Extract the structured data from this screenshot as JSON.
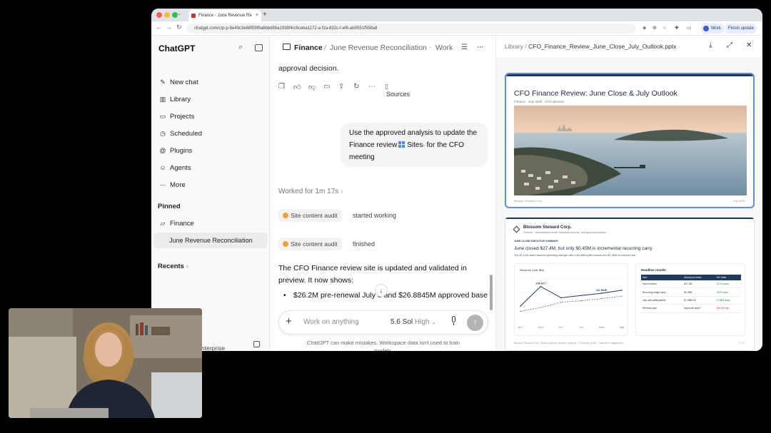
{
  "browser": {
    "tab_title": "Finance - June Revenue Re",
    "new_tab": "+",
    "url": "chatgpt.com/c/p-p-8e49c3e68f59f9a6bbd98a1938f4/c6ceba1172-a f2a-832c-f-ef6-ab0551f558a8",
    "profile_label": "Work",
    "finish_label": "Finish update"
  },
  "sidebar": {
    "brand": "ChatGPT",
    "items": [
      {
        "label": "New chat",
        "icon": "edit-icon"
      },
      {
        "label": "Library",
        "icon": "library-icon"
      },
      {
        "label": "Projects",
        "icon": "folder-icon"
      },
      {
        "label": "Scheduled",
        "icon": "clock-icon"
      },
      {
        "label": "Plugins",
        "icon": "plugin-icon"
      },
      {
        "label": "Agents",
        "icon": "robot-icon"
      },
      {
        "label": "More",
        "icon": "more-icon"
      }
    ],
    "pinned_heading": "Pinned",
    "pinned_project": "Finance",
    "pinned_conversation": "June Revenue Reconciliation",
    "recents_heading": "Recents",
    "recents_chevron": "›",
    "plan_label": "nterprise"
  },
  "chat": {
    "breadcrumb": {
      "project": "Finance",
      "separator": "/",
      "conversation": "June Revenue Reconciliation",
      "dot": "·",
      "mode": "Work"
    },
    "cutoff_text": "approval decision.",
    "sources_label": "Sources",
    "user_message": {
      "before": "Use the approved analysis to update the Finance review",
      "chip": "Sites",
      "after": "for the CFO meeting"
    },
    "worked_for": "Worked for 1m 17s",
    "tool_events": [
      {
        "name": "Site content audit",
        "status": "started working"
      },
      {
        "name": "Site content audit",
        "status": "finished"
      }
    ],
    "response_intro": "The CFO Finance review site is updated and validated in preview. It now shows:",
    "response_bullet": "$26.2M pre-renewal July ",
    "response_bullet_tail": "e and $26.8845M approved base",
    "composer": {
      "placeholder": "Work on anything",
      "model": "5.6 Sol",
      "effort": "High"
    },
    "disclaimer": "ChatGPT can make mistakes. Workspace data isn't used to train models."
  },
  "preview": {
    "library_label": "Library",
    "separator": "/",
    "filename": "CFO_Finance_Review_June_Close_July_Outlook.pptx",
    "slide1": {
      "title": "CFO Finance Review: June Close & July Outlook",
      "subtitle": "Finance · July 2025 · CFO decision",
      "footer_left": "Blossom Steward Corp.",
      "footer_right": "July 2025"
    },
    "slide2": {
      "company": "Blossom Steward Corp.",
      "subtitle": "Finance · Assumptions audit, modeled controls, and approval actions",
      "kicker": "JUNE CLOSE EXECUTIVE SUMMARY",
      "headline": "June closed $27.4M, but only $0.45M is incremental recurring carry",
      "detail": "The $1.01M asset takeout operating strength with a $0.68M uplift forward and $1.38M of renewal risk.",
      "chart_title": "Revenue (unit: $M)",
      "table_title": "Headline results",
      "table_headers": [
        "Item",
        "Actual (vs close)",
        "YoY delta"
      ],
      "table_rows": [
        [
          "June revenue",
          "$27.4M",
          "+6.1% carry"
        ],
        [
          "Recurring usage carry",
          "$0.45M",
          "+67% carry"
        ],
        [
          "July rate uplift/pipeline",
          "$1.38M net",
          "+0.68M adds"
        ],
        [
          "Renewal plan",
          "Approval watch",
          "-$11.4M risk"
        ]
      ],
      "footer_left": "Blossom Steward Corp.     Finance general revenue analysis · Financing model · Customer engagement",
      "footer_right": "2 / 5"
    }
  },
  "chart_data": {
    "type": "line",
    "title": "Revenue (unit: $M)",
    "categories": [
      "Jun T",
      "Jun E",
      "Jul T",
      "Cur",
      "Trave",
      "High"
    ],
    "annotations": [
      "JUN ACT",
      "JUL BASE"
    ],
    "series": [
      {
        "values": [
          24.8,
          27.4,
          25.9,
          26.2,
          26.5,
          26.9
        ],
        "style": "solid",
        "color": "#1f3a5f"
      },
      {
        "values": [
          24.1,
          24.6,
          25.3,
          25.5,
          25.8,
          26.1
        ],
        "style": "dashed",
        "color": "#7a8fb0"
      }
    ],
    "ylim": [
      23,
      28.5
    ]
  },
  "colors": {
    "accent": "#5b8def",
    "navy": "#1f3a5f",
    "chip_dot": "#f0a03a"
  }
}
